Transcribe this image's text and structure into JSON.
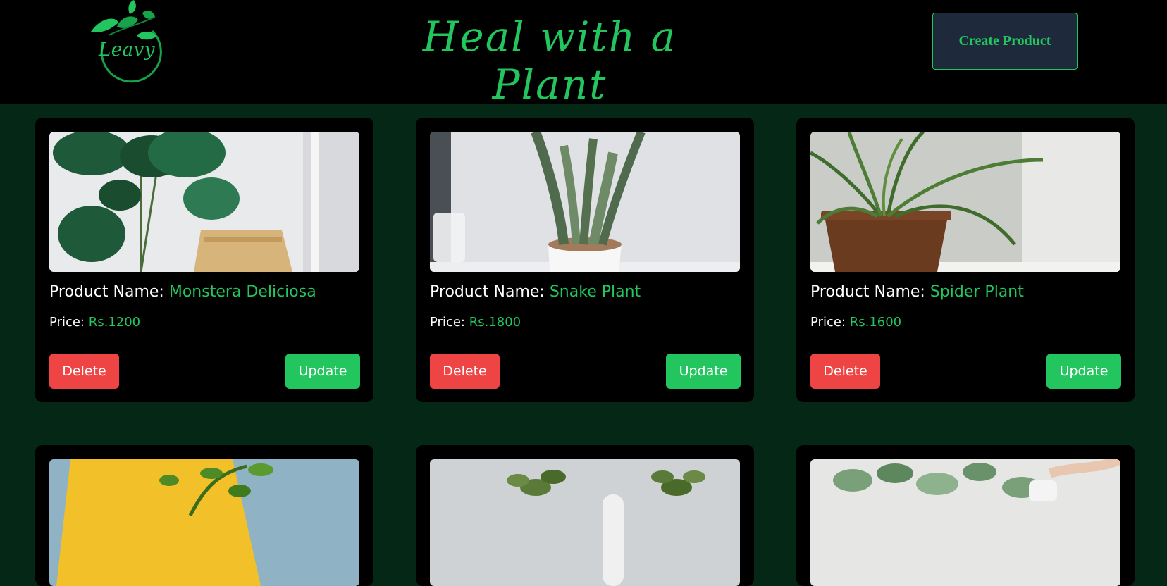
{
  "header": {
    "logo_text": "Leavy",
    "title": "Heal with a Plant",
    "create_button": "Create Product"
  },
  "labels": {
    "product_name": "Product Name:",
    "price": "Price:",
    "delete": "Delete",
    "update": "Update"
  },
  "products": [
    {
      "name": "Monstera Deliciosa",
      "price": "Rs.1200"
    },
    {
      "name": "Snake Plant",
      "price": "Rs.1800"
    },
    {
      "name": "Spider Plant",
      "price": "Rs.1600"
    }
  ],
  "colors": {
    "background": "#052816",
    "header": "#000000",
    "accent": "#22c55e",
    "delete": "#ef4444",
    "update": "#22c55e"
  }
}
